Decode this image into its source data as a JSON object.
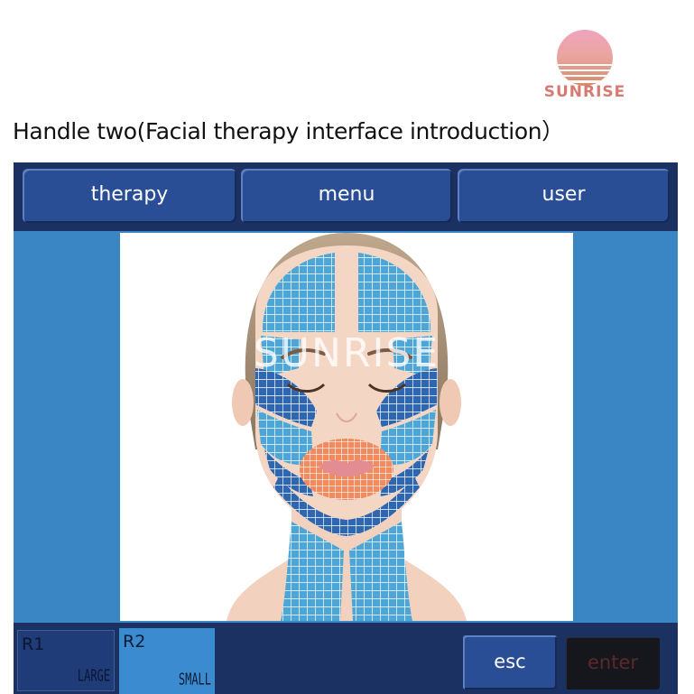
{
  "brand": {
    "name": "SUNRISE",
    "icon": "sunset-icon"
  },
  "heading": "Handle two(Facial therapy interface introduction）",
  "tabs": [
    {
      "label": "therapy"
    },
    {
      "label": "menu"
    },
    {
      "label": "user"
    }
  ],
  "main": {
    "image": {
      "subject": "face-treatment-map-icon",
      "watermark": "SUNRISE"
    }
  },
  "bottom": {
    "r1": {
      "label": "R1",
      "sub": "LARGE"
    },
    "r2": {
      "label": "R2",
      "sub": "SMALL"
    },
    "esc_label": "esc",
    "enter_label": "enter"
  },
  "colors": {
    "screen_bg": "#1b3161",
    "button": "#2a4e96",
    "content_bg": "#3a85c4",
    "zone_light": "#4ea6d6",
    "zone_dark": "#2f66b0",
    "zone_lips": "#f08a5f",
    "brand": "#d77a73"
  }
}
